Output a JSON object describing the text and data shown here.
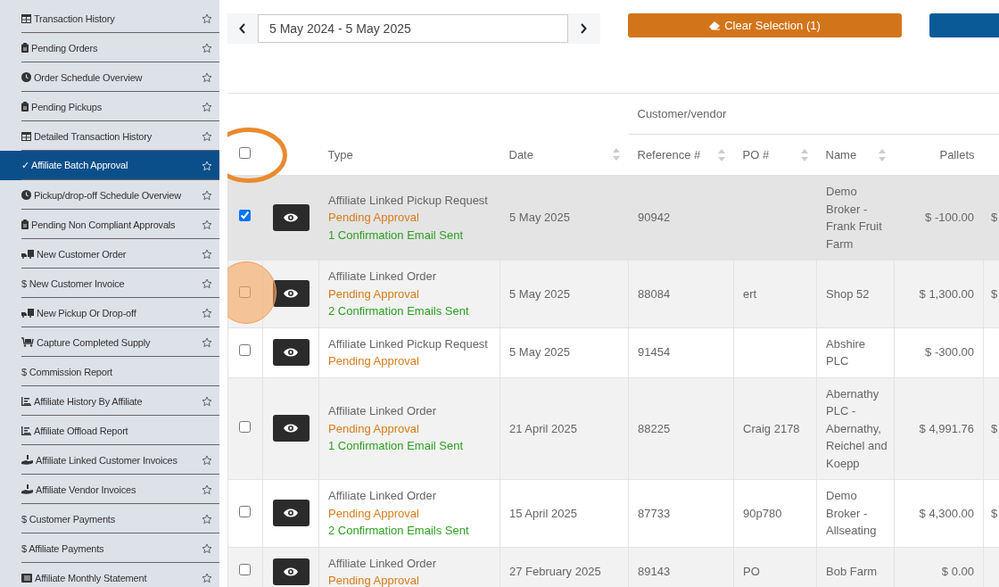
{
  "sidebar": {
    "items": [
      {
        "kind": "table",
        "label": "Transaction History",
        "selected": false,
        "star": true
      },
      {
        "kind": "clipboard",
        "label": "Pending Orders",
        "selected": false,
        "star": true
      },
      {
        "kind": "clock",
        "label": "Order Schedule Overview",
        "selected": false,
        "star": true
      },
      {
        "kind": "clipboard",
        "label": "Pending Pickups",
        "selected": false,
        "star": true
      },
      {
        "kind": "table",
        "label": "Detailed Transaction History",
        "selected": false,
        "star": true
      },
      {
        "kind": "text",
        "label": "✓ Affiliate Batch Approval",
        "selected": true,
        "star": true
      },
      {
        "kind": "clock",
        "label": "Pickup/drop-off Schedule Overview",
        "selected": false,
        "star": true
      },
      {
        "kind": "clipboard",
        "label": "Pending Non Compliant Approvals",
        "selected": false,
        "star": true
      },
      {
        "kind": "truck",
        "label": "New Customer Order",
        "selected": false,
        "star": true
      },
      {
        "kind": "text",
        "label": "$ New Customer Invoice",
        "selected": false,
        "star": true
      },
      {
        "kind": "truck",
        "label": "New Pickup Or Drop-off",
        "selected": false,
        "star": true
      },
      {
        "kind": "cart",
        "label": "Capture Completed Supply",
        "selected": false,
        "star": true
      },
      {
        "kind": "text",
        "label": "$ Commission Report",
        "selected": false,
        "star": false
      },
      {
        "kind": "chart",
        "label": "Affiliate History By Affiliate",
        "selected": false,
        "star": true
      },
      {
        "kind": "chart",
        "label": "Affiliate Offload Report",
        "selected": false,
        "star": false
      },
      {
        "kind": "hand",
        "label": "Affiliate Linked Customer Invoices",
        "selected": false,
        "star": true
      },
      {
        "kind": "hand",
        "label": "Affiliate Vendor Invoices",
        "selected": false,
        "star": true
      },
      {
        "kind": "text",
        "label": "$ Customer Payments",
        "selected": false,
        "star": true
      },
      {
        "kind": "text",
        "label": "$ Affiliate Payments",
        "selected": false,
        "star": true
      },
      {
        "kind": "list",
        "label": "Affiliate Monthly Statement",
        "selected": false,
        "star": true
      }
    ]
  },
  "date_range": {
    "value": "5 May 2024 - 5 May 2025"
  },
  "buttons": [
    {
      "kind": "clear",
      "label": "Clear Selection (1)"
    },
    {
      "kind": "primary"
    }
  ],
  "table": {
    "group_header": "Customer/vendor",
    "select_all": {
      "checked": false
    },
    "columns": [
      {
        "label": "Type",
        "sortable": false
      },
      {
        "label": "Date",
        "sortable": true
      },
      {
        "label": "Reference #",
        "sortable": true
      },
      {
        "label": "PO #",
        "sortable": true
      },
      {
        "label": "Name",
        "sortable": true
      },
      {
        "label": "Pallets",
        "sortable": false
      }
    ],
    "rows": [
      {
        "selected": true,
        "type": "Affiliate Linked Pickup Request",
        "status": "Pending Approval",
        "emails": "1 Confirmation Email Sent",
        "date": "5 May 2025",
        "reference": "90942",
        "po": "",
        "name": "Demo Broker - Frank Fruit Farm",
        "pallets": "$ -100.00",
        "column_9": "$"
      },
      {
        "selected": false,
        "type": "Affiliate Linked Order",
        "status": "Pending Approval",
        "emails": "2 Confirmation Emails Sent",
        "date": "5 May 2025",
        "reference": "88084",
        "po": "ert",
        "name": "Shop 52",
        "pallets": "$ 1,300.00",
        "column_9": "$"
      },
      {
        "selected": false,
        "type": "Affiliate Linked Pickup Request",
        "status": "Pending Approval",
        "emails": "",
        "date": "5 May 2025",
        "reference": "91454",
        "po": "",
        "name": "Abshire PLC",
        "pallets": "$ -300.00",
        "column_9": ""
      },
      {
        "selected": false,
        "type": "Affiliate Linked Order",
        "status": "Pending Approval",
        "emails": "1 Confirmation Email Sent",
        "date": "21 April 2025",
        "reference": "88225",
        "po": "Craig 2178",
        "name": "Abernathy PLC - Abernathy, Reichel and Koepp",
        "pallets": "$ 4,991.76",
        "column_9": "$"
      },
      {
        "selected": false,
        "type": "Affiliate Linked Order",
        "status": "Pending Approval",
        "emails": "2 Confirmation Emails Sent",
        "date": "15 April 2025",
        "reference": "87733",
        "po": "90p780",
        "name": "Demo Broker - Allseating",
        "pallets": "$ 4,300.00",
        "column_9": "$"
      },
      {
        "selected": false,
        "type": "Affiliate Linked Order",
        "status": "Pending Approval",
        "emails": "",
        "date": "27 February 2025",
        "reference": "89143",
        "po": "PO",
        "name": "Bob Farm",
        "pallets": "$ 0.00",
        "column_9": ""
      }
    ]
  },
  "annotations": [
    {
      "kind": "ring"
    },
    {
      "kind": "dot"
    }
  ]
}
